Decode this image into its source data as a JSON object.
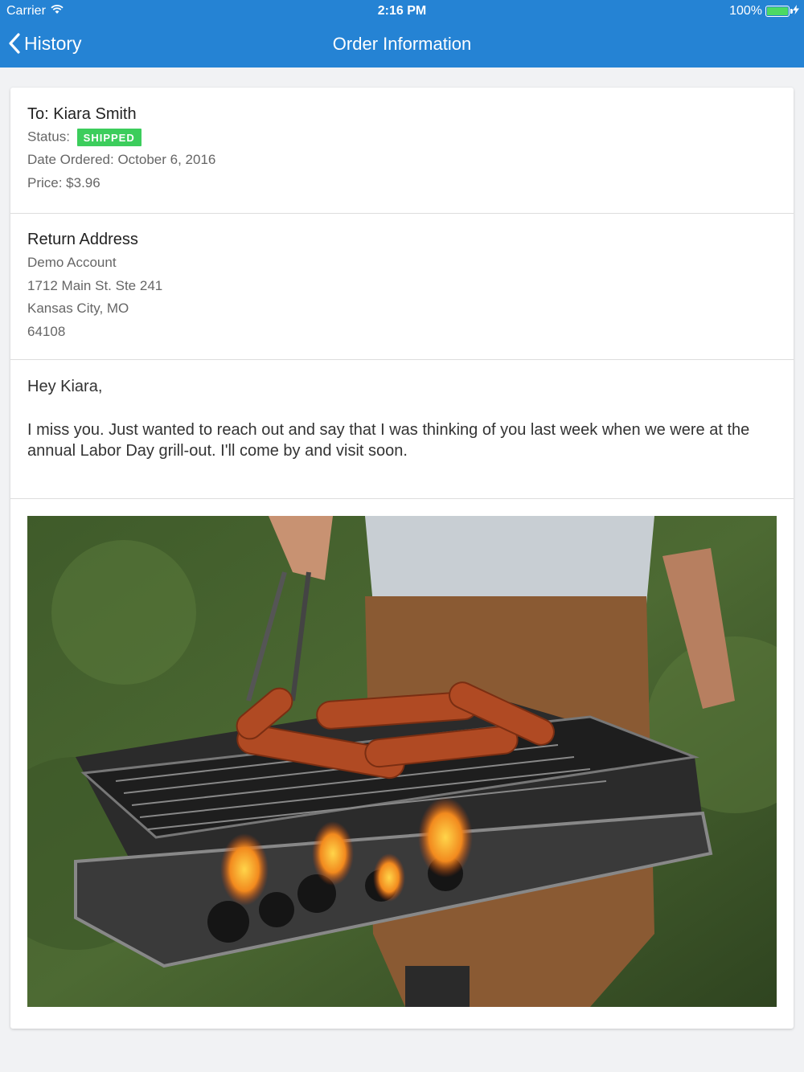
{
  "status_bar": {
    "carrier": "Carrier",
    "time": "2:16 PM",
    "battery": "100%",
    "battery_level": 1.0
  },
  "nav": {
    "back_label": "History",
    "title": "Order Information"
  },
  "order": {
    "to": "To: Kiara Smith",
    "status_label": "Status:",
    "status_badge": "SHIPPED",
    "date": "Date Ordered: October 6, 2016",
    "price": "Price: $3.96"
  },
  "return_address": {
    "heading": "Return Address",
    "lines": [
      "Demo Account",
      "1712 Main St. Ste 241",
      "Kansas City, MO",
      "64108"
    ]
  },
  "message": {
    "greeting": "Hey Kiara,",
    "body": "I miss you. Just wanted to reach out and say that I was thinking of you last week when we were at the annual Labor Day grill-out. I'll come by and visit soon."
  },
  "colors": {
    "nav_bar": "#2583d4",
    "status_badge": "#3ccd5c",
    "page_background": "#f1f2f4"
  }
}
